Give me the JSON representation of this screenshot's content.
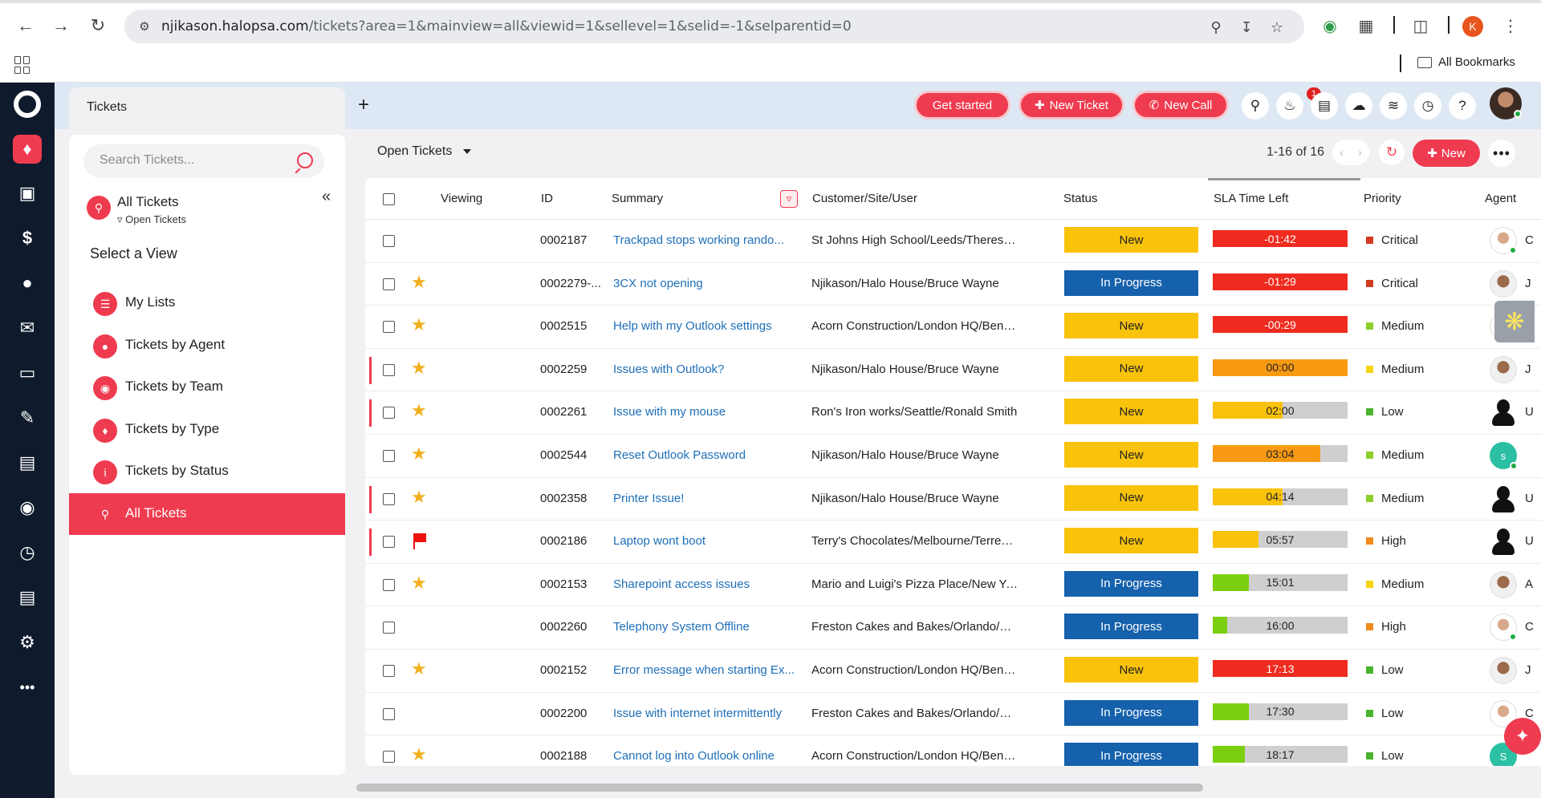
{
  "browser": {
    "url_host": "njikason.halopsa.com",
    "url_path": "/tickets?area=1&mainview=all&viewid=1&sellevel=1&selid=-1&selparentid=0",
    "profile_initial": "K",
    "bookmarks_label": "All Bookmarks"
  },
  "appbar": {
    "tab_label": "Tickets",
    "tab_add": "+",
    "get_started": "Get started",
    "new_ticket": "New Ticket",
    "new_call": "New Call",
    "notification_count": "1"
  },
  "sidebar": {
    "search_placeholder": "Search Tickets...",
    "current_view_title": "All Tickets",
    "current_view_sub": "Open Tickets",
    "select_view": "Select a View",
    "views": [
      {
        "label": "My Lists",
        "icon": "list-icon"
      },
      {
        "label": "Tickets by Agent",
        "icon": "person-icon"
      },
      {
        "label": "Tickets by Team",
        "icon": "team-icon"
      },
      {
        "label": "Tickets by Type",
        "icon": "ticket-icon"
      },
      {
        "label": "Tickets by Status",
        "icon": "info-icon"
      },
      {
        "label": "All Tickets",
        "icon": "search-icon",
        "active": true
      }
    ]
  },
  "main": {
    "view_selector": "Open Tickets",
    "pager": "1-16 of 16",
    "new_label": "New"
  },
  "columns": {
    "viewing": "Viewing",
    "id": "ID",
    "summary": "Summary",
    "customer": "Customer/Site/User",
    "status": "Status",
    "sla": "SLA Time Left",
    "priority": "Priority",
    "agent": "Agent"
  },
  "colors": {
    "accent": "#ef3b4f",
    "status_new": "#f9c20b",
    "status_in_progress": "#1561ac",
    "sla_red": "#ef2b1f",
    "sla_orange": "#f79a12",
    "sla_yellow": "#f9c20b",
    "sla_green": "#7ccf10",
    "prio_critical": "#d23a20",
    "prio_high": "#f08a1a",
    "prio_medium_yellow": "#f5d50f",
    "prio_medium_green": "#8ccf2a",
    "prio_low": "#49b32e"
  },
  "tickets": [
    {
      "id": "0002187",
      "summary": "Trackpad stops working rando...",
      "customer": "St Johns High School/Leeds/Theresa Sa...",
      "status": "New",
      "sla": "-01:42",
      "sla_fill": 1.0,
      "sla_color": "#ef2b1f",
      "priority": "Critical",
      "prio_color": "#d23a20",
      "mark": "",
      "flagbar": false,
      "agent_style": "av-photo-a",
      "agent_text": "C",
      "agent_dot": true
    },
    {
      "id": "0002279-...",
      "summary": "3CX not opening",
      "customer": "Njikason/Halo House/Bruce Wayne",
      "status": "In Progress",
      "sla": "-01:29",
      "sla_fill": 1.0,
      "sla_color": "#ef2b1f",
      "priority": "Critical",
      "prio_color": "#d23a20",
      "mark": "star",
      "flagbar": false,
      "agent_style": "av-photo-b",
      "agent_text": "J",
      "agent_dot": false
    },
    {
      "id": "0002515",
      "summary": "Help with my Outlook settings",
      "customer": "Acorn Construction/London HQ/Ben Cas...",
      "status": "New",
      "sla": "-00:29",
      "sla_fill": 1.0,
      "sla_color": "#ef2b1f",
      "priority": "Medium",
      "prio_color": "#8ccf2a",
      "mark": "star",
      "flagbar": false,
      "agent_style": "av-photo-a",
      "agent_text": "",
      "agent_dot": false
    },
    {
      "id": "0002259",
      "summary": "Issues with Outlook?",
      "customer": "Njikason/Halo House/Bruce Wayne",
      "status": "New",
      "sla": "00:00",
      "sla_fill": 1.0,
      "sla_color": "#f79a12",
      "priority": "Medium",
      "prio_color": "#f5d50f",
      "mark": "star",
      "flagbar": true,
      "agent_style": "av-photo-b",
      "agent_text": "J",
      "agent_dot": false
    },
    {
      "id": "0002261",
      "summary": "Issue with my mouse",
      "customer": "Ron's Iron works/Seattle/Ronald Smith",
      "status": "New",
      "sla": "02:00",
      "sla_fill": 0.52,
      "sla_color": "#f9c20b",
      "priority": "Low",
      "prio_color": "#49b32e",
      "mark": "star",
      "flagbar": true,
      "agent_style": "av-sil",
      "agent_text": "U",
      "agent_dot": false
    },
    {
      "id": "0002544",
      "summary": "Reset Outlook Password",
      "customer": "Njikason/Halo House/Bruce Wayne",
      "status": "New",
      "sla": "03:04",
      "sla_fill": 0.8,
      "sla_color": "#f79a12",
      "priority": "Medium",
      "prio_color": "#8ccf2a",
      "mark": "star",
      "flagbar": false,
      "agent_style": "av-s",
      "agent_text": "s",
      "agent_dot": true
    },
    {
      "id": "0002358",
      "summary": "Printer Issue!",
      "customer": "Njikason/Halo House/Bruce Wayne",
      "status": "New",
      "sla": "04:14",
      "sla_fill": 0.52,
      "sla_color": "#f9c20b",
      "priority": "Medium",
      "prio_color": "#8ccf2a",
      "mark": "star",
      "flagbar": true,
      "agent_style": "av-sil",
      "agent_text": "U",
      "agent_dot": false
    },
    {
      "id": "0002186",
      "summary": "Laptop wont boot",
      "customer": "Terry's Chocolates/Melbourne/Terrence ...",
      "status": "New",
      "sla": "05:57",
      "sla_fill": 0.34,
      "sla_color": "#f9c20b",
      "priority": "High",
      "prio_color": "#f08a1a",
      "mark": "flag",
      "flagbar": true,
      "agent_style": "av-sil",
      "agent_text": "U",
      "agent_dot": false
    },
    {
      "id": "0002153",
      "summary": "Sharepoint access issues",
      "customer": "Mario and Luigi's Pizza Place/New York/Lu...",
      "status": "In Progress",
      "sla": "15:01",
      "sla_fill": 0.27,
      "sla_color": "#7ccf10",
      "priority": "Medium",
      "prio_color": "#f5d50f",
      "mark": "star",
      "flagbar": false,
      "agent_style": "av-photo-b",
      "agent_text": "A",
      "agent_dot": false
    },
    {
      "id": "0002260",
      "summary": "Telephony System Offline",
      "customer": "Freston Cakes and Bakes/Orlando/Emm...",
      "status": "In Progress",
      "sla": "16:00",
      "sla_fill": 0.11,
      "sla_color": "#7ccf10",
      "priority": "High",
      "prio_color": "#f08a1a",
      "mark": "",
      "flagbar": false,
      "agent_style": "av-photo-a",
      "agent_text": "C",
      "agent_dot": true
    },
    {
      "id": "0002152",
      "summary": "Error message when starting Ex...",
      "customer": "Acorn Construction/London HQ/Ben Cas...",
      "status": "New",
      "sla": "17:13",
      "sla_fill": 1.0,
      "sla_color": "#ef2b1f",
      "priority": "Low",
      "prio_color": "#49b32e",
      "mark": "star",
      "flagbar": false,
      "agent_style": "av-photo-b",
      "agent_text": "J",
      "agent_dot": false
    },
    {
      "id": "0002200",
      "summary": "Issue with internet intermittently",
      "customer": "Freston Cakes and Bakes/Orlando/Emm...",
      "status": "In Progress",
      "sla": "17:30",
      "sla_fill": 0.27,
      "sla_color": "#7ccf10",
      "priority": "Low",
      "prio_color": "#49b32e",
      "mark": "",
      "flagbar": false,
      "agent_style": "av-photo-a",
      "agent_text": "C",
      "agent_dot": false
    },
    {
      "id": "0002188",
      "summary": "Cannot log into Outlook online",
      "customer": "Acorn Construction/London HQ/Ben Cas...",
      "status": "In Progress",
      "sla": "18:17",
      "sla_fill": 0.24,
      "sla_color": "#7ccf10",
      "priority": "Low",
      "prio_color": "#49b32e",
      "mark": "star",
      "flagbar": false,
      "agent_style": "av-s",
      "agent_text": "S",
      "agent_dot": false
    }
  ]
}
